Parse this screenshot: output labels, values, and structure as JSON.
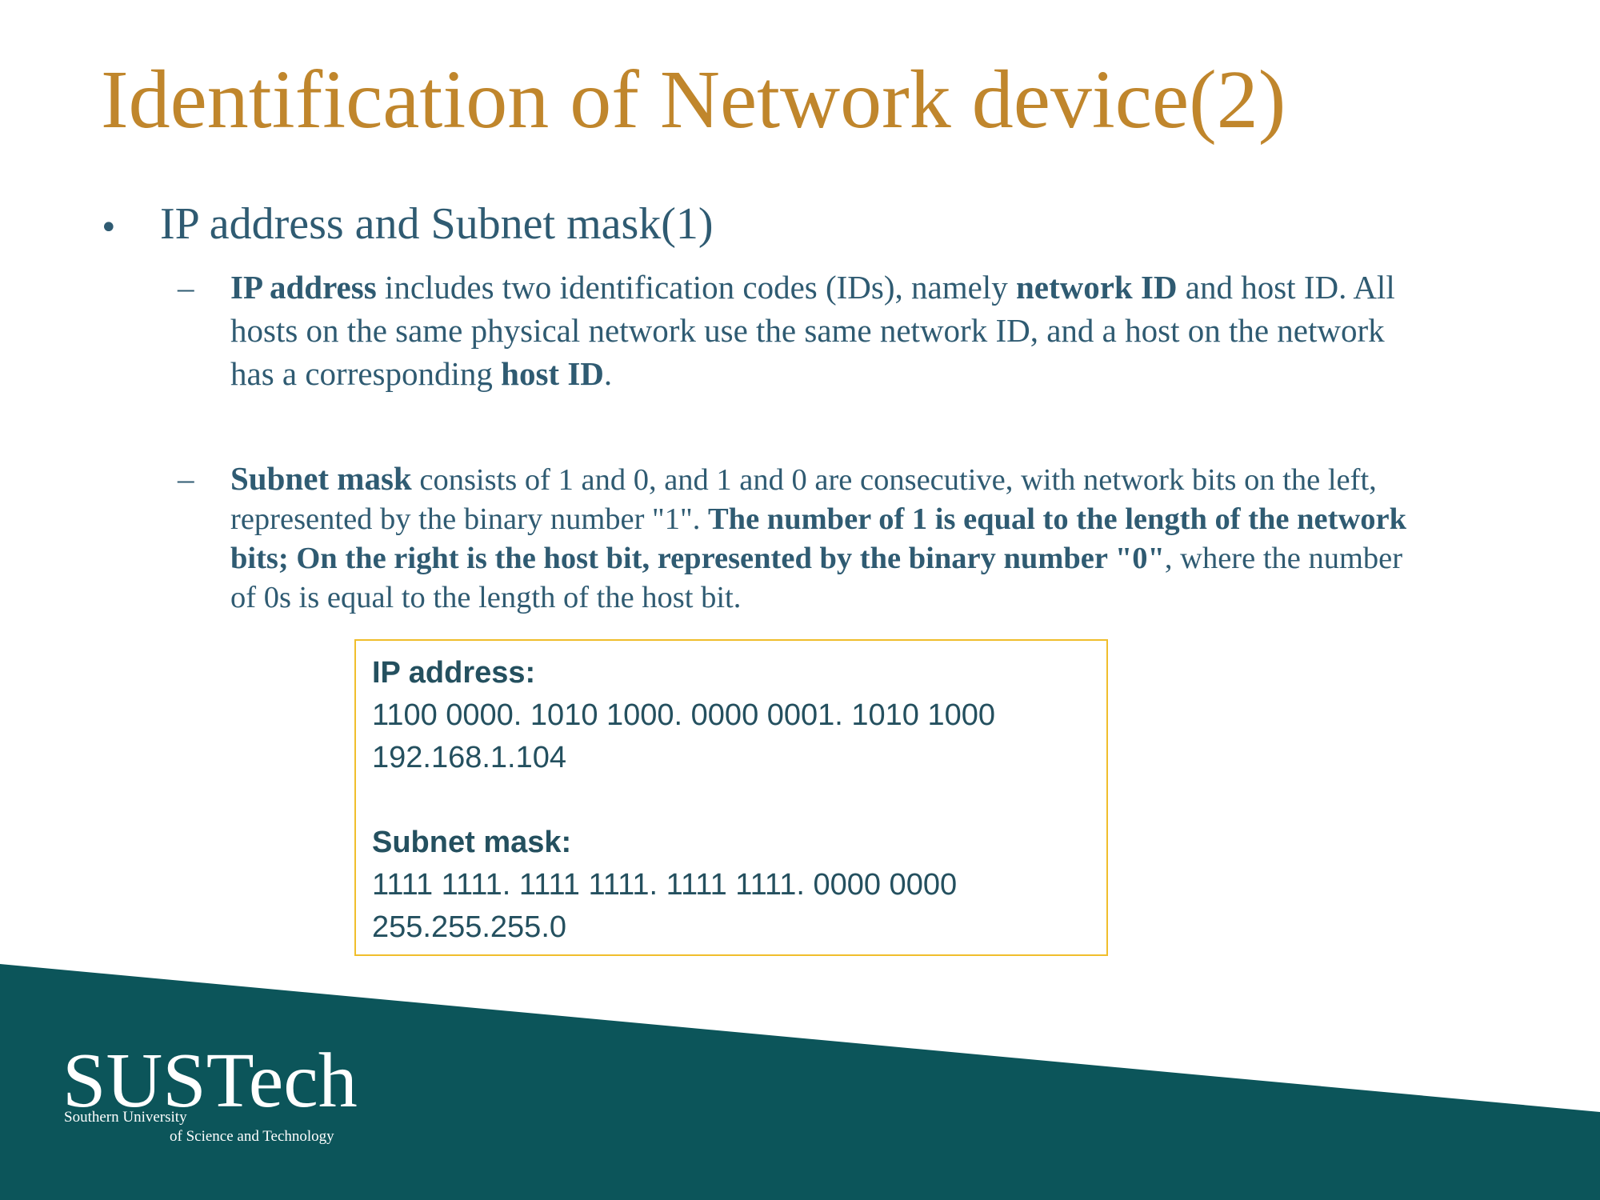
{
  "title": "Identification of Network device(2)",
  "colors": {
    "title": "#c0862c",
    "body_text": "#2f5b72",
    "box_border": "#f0be2c",
    "footer_band": "#0c555a"
  },
  "bullet": {
    "text": "IP address and Subnet mask(1)"
  },
  "items": [
    {
      "dash": "–",
      "term": "IP address",
      "text1": " includes two identification codes (IDs), namely ",
      "bold1": "network ID",
      "text2": " and host ID. All hosts on the same physical network use the same network ID, and a host on the network has a corresponding ",
      "bold2": "host ID",
      "text3": "."
    },
    {
      "dash": "–",
      "term": "Subnet mask",
      "text1": " consists of 1 and 0, and 1 and 0 are consecutive, with network bits on the left, represented by the binary number \"1\". ",
      "bold1": "The number of 1 is equal to the length of the network bits; On the right is the host bit, represented by the binary number \"0\"",
      "text2": ", where the number of 0s is equal to the length of the host bit."
    }
  ],
  "box": {
    "ip_heading": "IP address:",
    "ip_binary": "1100 0000. 1010 1000. 0000 0001. 1010 1000",
    "ip_decimal": "192.168.1.104",
    "mask_heading": "Subnet mask:",
    "mask_binary": "1111 1111. 1111 1111. 1111 1111. 0000 0000",
    "mask_decimal": "255.255.255.0"
  },
  "logo": {
    "name": "SUSTech",
    "line1": "Southern University",
    "line2": "of Science and Technology"
  }
}
